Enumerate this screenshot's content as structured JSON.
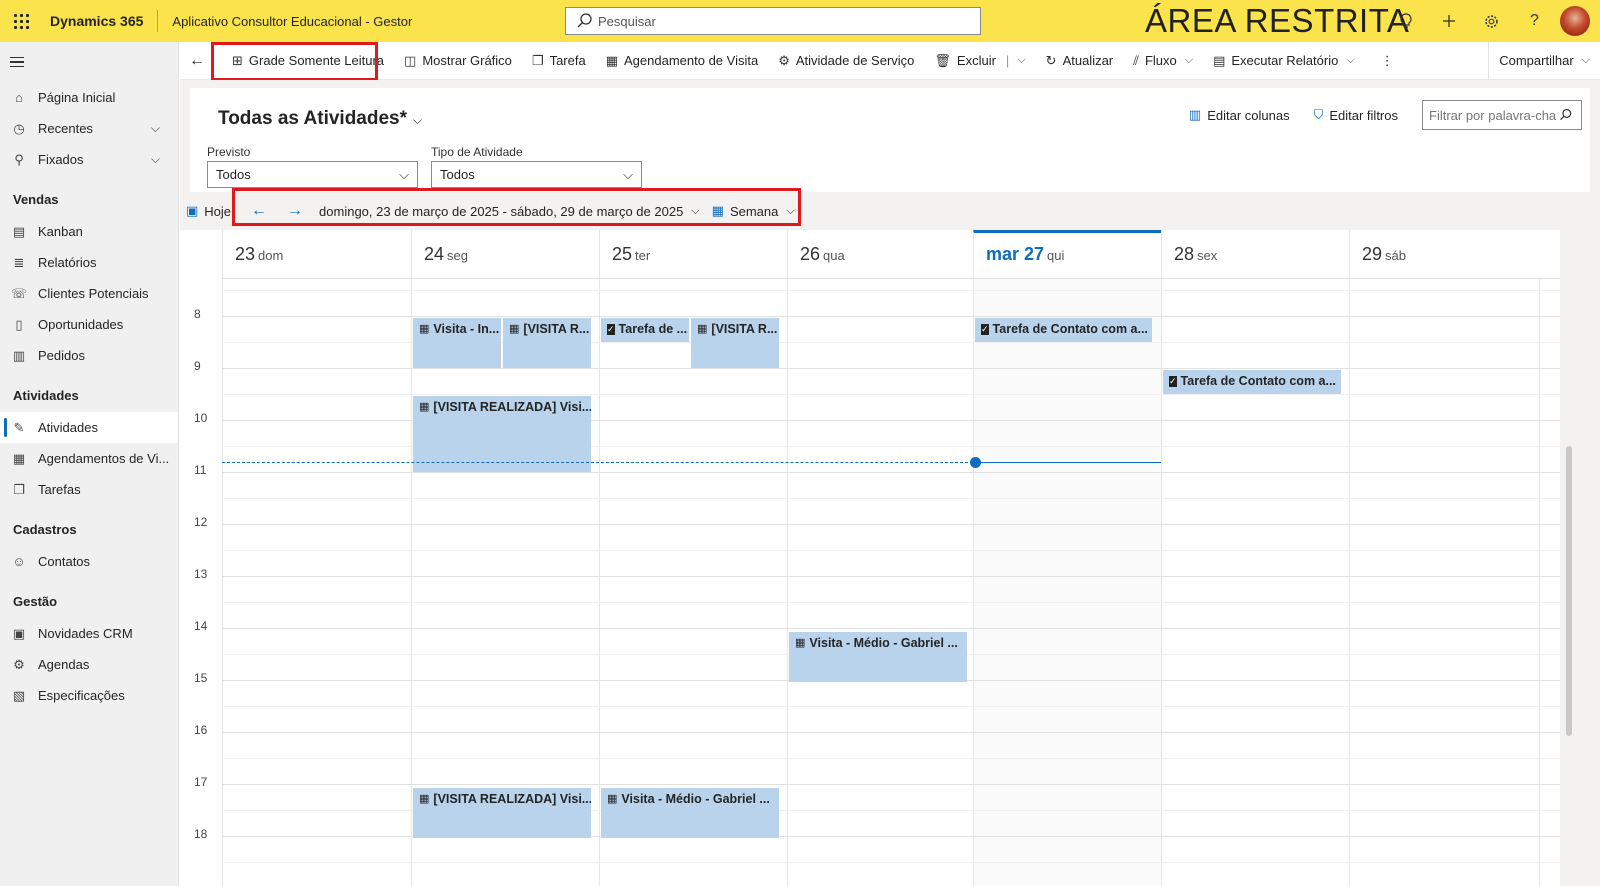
{
  "topbar": {
    "brand": "Dynamics 365",
    "app_name": "Aplicativo Consultor Educacional - Gestor",
    "search_placeholder": "Pesquisar",
    "banner": "ÁREA RESTRITA",
    "icons": [
      "lightbulb-icon",
      "plus-icon",
      "gear-icon",
      "help-icon"
    ]
  },
  "sidebar": {
    "top_items": [
      {
        "label": "Página Inicial",
        "icon": "home-icon"
      },
      {
        "label": "Recentes",
        "icon": "clock-icon"
      },
      {
        "label": "Fixados",
        "icon": "pin-icon"
      }
    ],
    "sections": [
      {
        "title": "Vendas",
        "items": [
          "Kanban",
          "Relatórios",
          "Clientes Potenciais",
          "Oportunidades",
          "Pedidos"
        ]
      },
      {
        "title": "Atividades",
        "items": [
          "Atividades",
          "Agendamentos de Vi...",
          "Tarefas"
        ]
      },
      {
        "title": "Cadastros",
        "items": [
          "Contatos"
        ]
      },
      {
        "title": "Gestão",
        "items": [
          "Novidades CRM",
          "Agendas",
          "Especificações"
        ]
      }
    ],
    "active_item": "Atividades"
  },
  "commandbar": {
    "items": [
      {
        "label": "Grade Somente Leitura",
        "icon": "grid-icon"
      },
      {
        "label": "Mostrar Gráfico",
        "icon": "chart-icon"
      },
      {
        "label": "Tarefa",
        "icon": "task-icon"
      },
      {
        "label": "Agendamento de Visita",
        "icon": "calendar-icon"
      },
      {
        "label": "Atividade de Serviço",
        "icon": "service-icon"
      },
      {
        "label": "Excluir",
        "icon": "trash-icon"
      },
      {
        "label": "Atualizar",
        "icon": "refresh-icon"
      },
      {
        "label": "Fluxo",
        "icon": "flow-icon"
      },
      {
        "label": "Executar Relatório",
        "icon": "report-icon"
      },
      {
        "label": "Compartilhar",
        "icon": "share-icon"
      }
    ]
  },
  "view": {
    "title": "Todas as Atividades*",
    "edit_columns": "Editar colunas",
    "edit_filters": "Editar filtros",
    "keyword_placeholder": "Filtrar por palavra-cha",
    "filters": [
      {
        "label": "Previsto",
        "value": "Todos"
      },
      {
        "label": "Tipo de Atividade",
        "value": "Todos"
      }
    ]
  },
  "calendar": {
    "today_button": "Hoje",
    "date_range": "domingo, 23 de março de 2025 - sábado, 29 de março de 2025",
    "view_mode": "Semana",
    "days": [
      {
        "num": "23",
        "name": "dom"
      },
      {
        "num": "24",
        "name": "seg"
      },
      {
        "num": "25",
        "name": "ter"
      },
      {
        "num": "26",
        "name": "qua"
      },
      {
        "num": "mar 27",
        "name": "qui"
      },
      {
        "num": "28",
        "name": "sex"
      },
      {
        "num": "29",
        "name": "sáb"
      }
    ],
    "hours": [
      "8",
      "9",
      "10",
      "11",
      "12",
      "13",
      "14",
      "15",
      "16",
      "17",
      "18"
    ],
    "events": [
      {
        "title": "Visita - In...",
        "kind": "visit"
      },
      {
        "title": "[VISITA R...",
        "kind": "visit"
      },
      {
        "title": "Tarefa de ...",
        "kind": "task"
      },
      {
        "title": "[VISITA R...",
        "kind": "visit"
      },
      {
        "title": "Tarefa de Contato com a...",
        "kind": "task"
      },
      {
        "title": "Tarefa de Contato com a...",
        "kind": "task"
      },
      {
        "title": "[VISITA REALIZADA] Visi...",
        "kind": "visit"
      },
      {
        "title": "Visita - Médio - Gabriel ...",
        "kind": "visit"
      },
      {
        "title": "[VISITA REALIZADA] Visi...",
        "kind": "visit"
      },
      {
        "title": "Visita - Médio - Gabriel ...",
        "kind": "visit"
      }
    ]
  },
  "colors": {
    "topbar": "#fbe34b",
    "accent": "#0f6cbd",
    "event": "#bad3ec",
    "highlight": "#e0191f"
  }
}
